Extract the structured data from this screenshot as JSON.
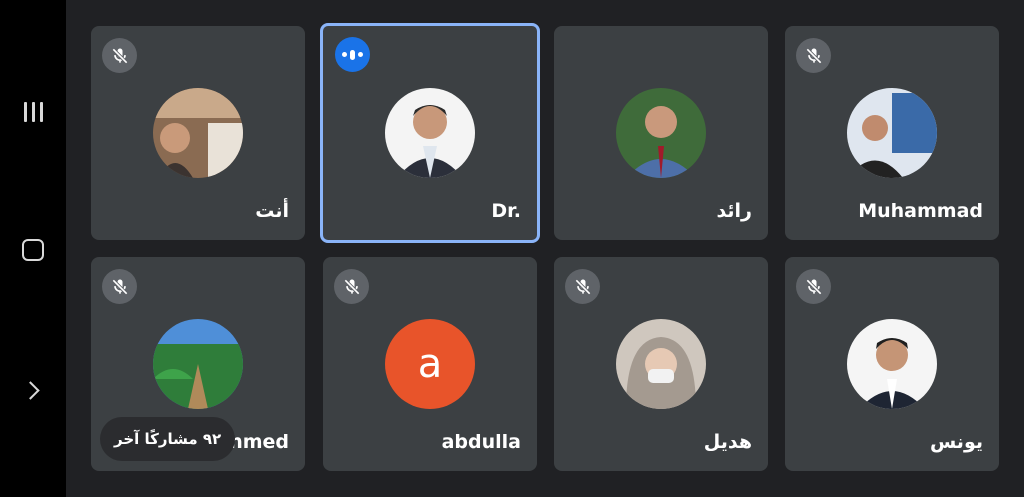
{
  "participants": [
    {
      "name": "أنت",
      "muted": true,
      "speaking": false,
      "avatar_type": "photo"
    },
    {
      "name": "Dr.",
      "muted": false,
      "speaking": true,
      "avatar_type": "photo"
    },
    {
      "name": "رائد",
      "muted": false,
      "speaking": false,
      "avatar_type": "photo"
    },
    {
      "name": "Muhammad",
      "muted": true,
      "speaking": false,
      "avatar_type": "photo"
    },
    {
      "name": "hmed",
      "muted": true,
      "speaking": false,
      "avatar_type": "photo"
    },
    {
      "name": "abdulla",
      "muted": true,
      "speaking": false,
      "avatar_type": "letter",
      "avatar_letter": "a",
      "avatar_color": "#e8542a"
    },
    {
      "name": "هديل",
      "muted": true,
      "speaking": false,
      "avatar_type": "photo"
    },
    {
      "name": "يونس",
      "muted": true,
      "speaking": false,
      "avatar_type": "photo"
    }
  ],
  "overflow_label": "٩٢ مشاركًا آخر",
  "icons": {
    "mute": "mic-off-icon",
    "speaking": "audio-level-icon",
    "nav_recents": "recents-icon",
    "nav_home": "home-icon",
    "nav_back": "back-chevron-icon"
  },
  "colors": {
    "background": "#202124",
    "tile": "#3c4043",
    "active_border": "#8ab4f8",
    "speaking": "#1a73e8",
    "mute_badge": "#5f6368"
  }
}
